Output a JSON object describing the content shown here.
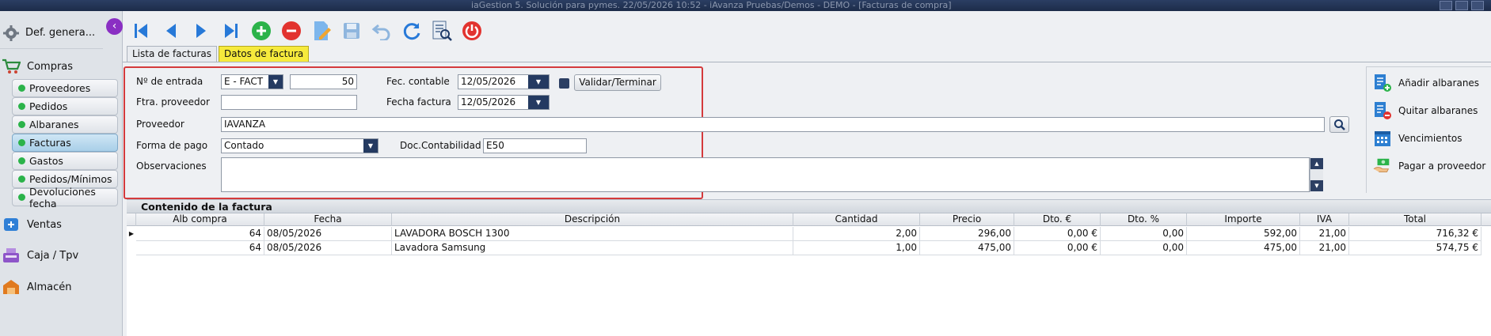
{
  "titlebar": {
    "title": "iaGestion 5. Solución para pymes.   22/05/2026 10:52   -   iAvanza Pruebas/Demos - DEMO - [Facturas de compra]"
  },
  "sidebar": {
    "top_label": "Def. genera...",
    "modules": [
      {
        "label": "Compras",
        "icon": "cart-icon"
      },
      {
        "label": "Ventas",
        "icon": "sales-icon"
      },
      {
        "label": "Caja / Tpv",
        "icon": "cash-register-icon"
      },
      {
        "label": "Almacén",
        "icon": "warehouse-icon"
      }
    ],
    "compras_items": [
      "Proveedores",
      "Pedidos",
      "Albaranes",
      "Facturas",
      "Gastos",
      "Pedidos/Mínimos",
      "Devoluciones fecha"
    ],
    "active_item": "Facturas"
  },
  "toolbar": {
    "buttons": [
      "first-record-icon",
      "previous-record-icon",
      "next-record-icon",
      "last-record-icon",
      "add-icon",
      "delete-icon",
      "edit-icon",
      "save-icon",
      "undo-icon",
      "refresh-icon",
      "search-list-icon",
      "power-icon"
    ]
  },
  "tabs": [
    "Lista de facturas",
    "Datos de factura"
  ],
  "form": {
    "entrada_label": "Nº de entrada",
    "serie_value": "E   - FACT",
    "entrada_number": "50",
    "ftra_label": "Ftra. proveedor",
    "ftra_value": "",
    "proveedor_label": "Proveedor",
    "proveedor_value": "IAVANZA",
    "forma_pago_label": "Forma de pago",
    "forma_pago_value": "Contado",
    "observaciones_label": "Observaciones",
    "observaciones_value": "",
    "fec_contable_label": "Fec. contable",
    "fec_contable_value": "12/05/2026",
    "fecha_factura_label": "Fecha factura",
    "fecha_factura_value": "12/05/2026",
    "validar_label": "Validar/Terminar",
    "doc_contabilidad_label": "Doc.Contabilidad",
    "doc_contabilidad_value": "E50"
  },
  "actions": {
    "anadir": "Añadir albaranes",
    "quitar": "Quitar albaranes",
    "vencimientos": "Vencimientos",
    "pagar": "Pagar a proveedor"
  },
  "contents": {
    "title": "Contenido de la factura",
    "columns": [
      "Alb compra",
      "Fecha",
      "Descripción",
      "Cantidad",
      "Precio",
      "Dto. €",
      "Dto. %",
      "Importe",
      "IVA",
      "Total"
    ],
    "rows": [
      [
        "64",
        "08/05/2026",
        "LAVADORA BOSCH 1300",
        "2,00",
        "296,00",
        "0,00 €",
        "0,00",
        "592,00",
        "21,00",
        "716,32 €"
      ],
      [
        "64",
        "08/05/2026",
        "Lavadora Samsung",
        "1,00",
        "475,00",
        "0,00 €",
        "0,00",
        "475,00",
        "21,00",
        "574,75 €"
      ]
    ]
  },
  "colors": {
    "accent_purple": "#8a2fc3",
    "active_tab": "#f6ea3c",
    "highlight_border": "#d43a3c",
    "status_green": "#2bb34a"
  }
}
